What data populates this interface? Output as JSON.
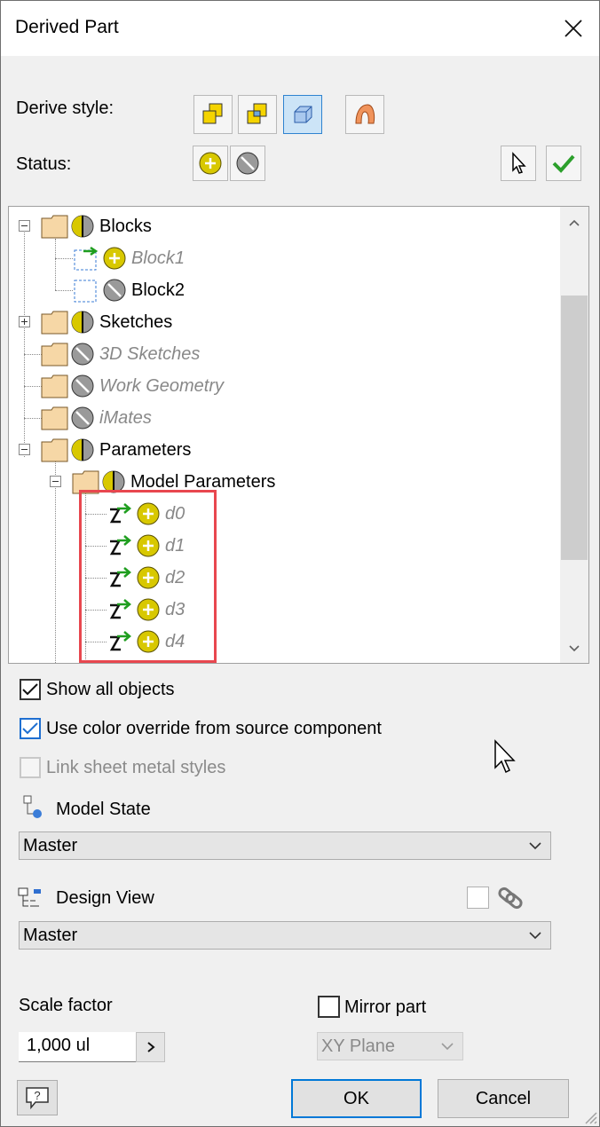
{
  "title": "Derived Part",
  "derive_style": {
    "label": "Derive style:",
    "buttons": [
      "single-solid-merge-icon",
      "solid-body-keep-seams-icon",
      "solid-body-composite-icon",
      "surface-body-icon"
    ]
  },
  "status": {
    "label": "Status:"
  },
  "tree": {
    "items": [
      {
        "label": "Blocks",
        "status": "partial",
        "dim": false
      },
      {
        "label": "Block1",
        "status": "include",
        "dim": true
      },
      {
        "label": "Block2",
        "status": "exclude",
        "dim": false
      },
      {
        "label": "Sketches",
        "status": "partial",
        "dim": false
      },
      {
        "label": "3D Sketches",
        "status": "exclude",
        "dim": true
      },
      {
        "label": "Work Geometry",
        "status": "exclude",
        "dim": true
      },
      {
        "label": "iMates",
        "status": "exclude",
        "dim": true
      },
      {
        "label": "Parameters",
        "status": "partial",
        "dim": false
      },
      {
        "label": "Model Parameters",
        "status": "partial",
        "dim": false
      },
      {
        "label": "d0",
        "status": "include",
        "dim": true
      },
      {
        "label": "d1",
        "status": "include",
        "dim": true
      },
      {
        "label": "d2",
        "status": "include",
        "dim": true
      },
      {
        "label": "d3",
        "status": "include",
        "dim": true
      },
      {
        "label": "d4",
        "status": "include",
        "dim": true
      }
    ]
  },
  "options": {
    "show_all": {
      "label": "Show all objects",
      "checked": true
    },
    "color_override": {
      "label": "Use color override from source component",
      "checked": true
    },
    "link_sheet_metal": {
      "label": "Link sheet metal styles",
      "checked": false,
      "disabled": true
    }
  },
  "model_state": {
    "label": "Model State",
    "value": "Master"
  },
  "design_view": {
    "label": "Design View",
    "value": "Master"
  },
  "scale_factor": {
    "label": "Scale factor",
    "value": "1,000 ul"
  },
  "mirror": {
    "label": "Mirror part",
    "checked": false,
    "plane": "XY Plane"
  },
  "buttons": {
    "ok": "OK",
    "cancel": "Cancel",
    "help_icon": "help-icon"
  },
  "colors": {
    "accent": "#0078d7",
    "highlight": "#e8474f",
    "status_include": "#d8c800"
  }
}
